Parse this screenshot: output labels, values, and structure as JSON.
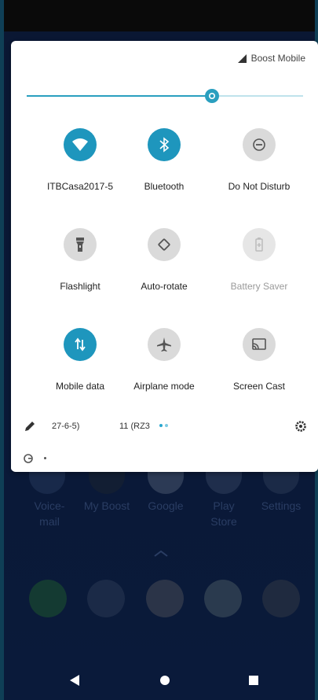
{
  "status": {
    "carrier": "Boost Mobile"
  },
  "brightness": {
    "level": 0.67
  },
  "tiles": [
    {
      "label": "ITBCasa2017-5",
      "icon": "wifi-icon",
      "state": "on"
    },
    {
      "label": "Bluetooth",
      "icon": "bluetooth-icon",
      "state": "on"
    },
    {
      "label": "Do Not Disturb",
      "icon": "do-not-disturb-icon",
      "state": "off"
    },
    {
      "label": "Flashlight",
      "icon": "flashlight-icon",
      "state": "off"
    },
    {
      "label": "Auto-rotate",
      "icon": "auto-rotate-icon",
      "state": "off"
    },
    {
      "label": "Battery Saver",
      "icon": "battery-saver-icon",
      "state": "disabled"
    },
    {
      "label": "Mobile data",
      "icon": "mobile-data-icon",
      "state": "on"
    },
    {
      "label": "Airplane mode",
      "icon": "airplane-icon",
      "state": "off"
    },
    {
      "label": "Screen Cast",
      "icon": "cast-icon",
      "state": "off"
    }
  ],
  "footer": {
    "build_left": "27-6-5)",
    "build_right": "11 (RZ3",
    "page_dots": 2
  },
  "home": {
    "apps": [
      {
        "label": "Voice-\nmail"
      },
      {
        "label": "My Boost"
      },
      {
        "label": "Google"
      },
      {
        "label": "Play\nStore"
      },
      {
        "label": "Settings"
      }
    ],
    "dock": [
      "phone-icon",
      "messages-icon",
      "chrome-icon",
      "photos-icon",
      "camera-icon"
    ]
  },
  "colors": {
    "accent": "#1e96bd",
    "tile_off": "#dadada",
    "background": "#0a1733"
  }
}
